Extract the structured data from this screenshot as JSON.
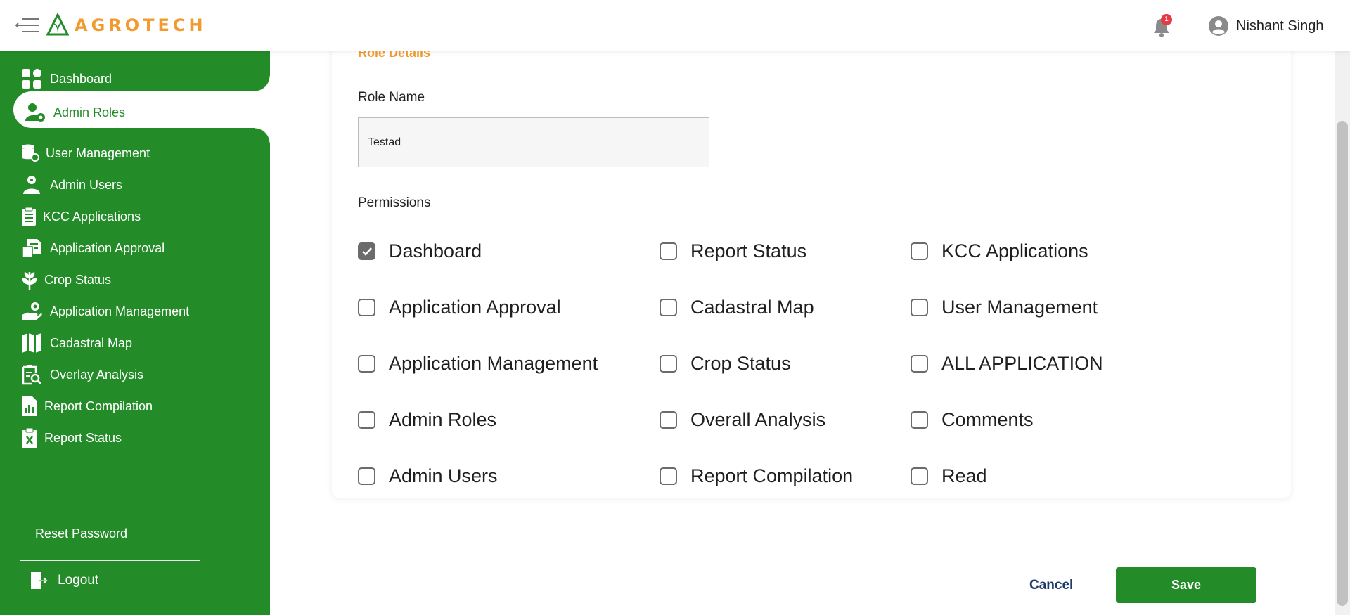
{
  "app": {
    "brand": "AGROTECH",
    "logo_small": "AGROTECH"
  },
  "header": {
    "notification_count": "1",
    "user_name": "Nishant Singh"
  },
  "sidebar": {
    "items": [
      {
        "label": "Dashboard",
        "icon": "grid-icon"
      },
      {
        "label": "Admin Roles",
        "icon": "user-gear-icon",
        "active": true
      },
      {
        "label": "User Management",
        "icon": "database-user-icon"
      },
      {
        "label": "Admin Users",
        "icon": "user-settings-icon"
      },
      {
        "label": "KCC Applications",
        "icon": "clipboard-list-icon"
      },
      {
        "label": "Application Approval",
        "icon": "document-approval-icon"
      },
      {
        "label": "Crop Status",
        "icon": "plant-icon"
      },
      {
        "label": "Application Management",
        "icon": "hand-gear-icon"
      },
      {
        "label": "Cadastral Map",
        "icon": "map-icon"
      },
      {
        "label": "Overlay Analysis",
        "icon": "clipboard-search-icon"
      },
      {
        "label": "Report Compilation",
        "icon": "report-chart-icon"
      },
      {
        "label": "Report Status",
        "icon": "clipboard-x-icon"
      }
    ],
    "reset_password": "Reset Password",
    "logout": "Logout"
  },
  "form": {
    "section_title": "Role Details",
    "role_name_label": "Role Name",
    "role_name_value": "Testad",
    "permissions_label": "Permissions"
  },
  "permissions": [
    {
      "label": "Dashboard",
      "checked": true
    },
    {
      "label": "Report Status",
      "checked": false
    },
    {
      "label": "KCC Applications",
      "checked": false
    },
    {
      "label": "Application Approval",
      "checked": false
    },
    {
      "label": "Cadastral Map",
      "checked": false
    },
    {
      "label": "User Management",
      "checked": false
    },
    {
      "label": "Application Management",
      "checked": false
    },
    {
      "label": "Crop Status",
      "checked": false
    },
    {
      "label": "ALL APPLICATION",
      "checked": false
    },
    {
      "label": "Admin Roles",
      "checked": false
    },
    {
      "label": "Overall Analysis",
      "checked": false
    },
    {
      "label": "Comments",
      "checked": false
    },
    {
      "label": "Admin Users",
      "checked": false
    },
    {
      "label": "Report Compilation",
      "checked": false
    },
    {
      "label": "Read",
      "checked": false
    }
  ],
  "actions": {
    "cancel": "Cancel",
    "save": "Save"
  },
  "colors": {
    "brand_green": "#238c28",
    "accent_orange": "#f29a2e",
    "badge_red": "#e53946"
  }
}
